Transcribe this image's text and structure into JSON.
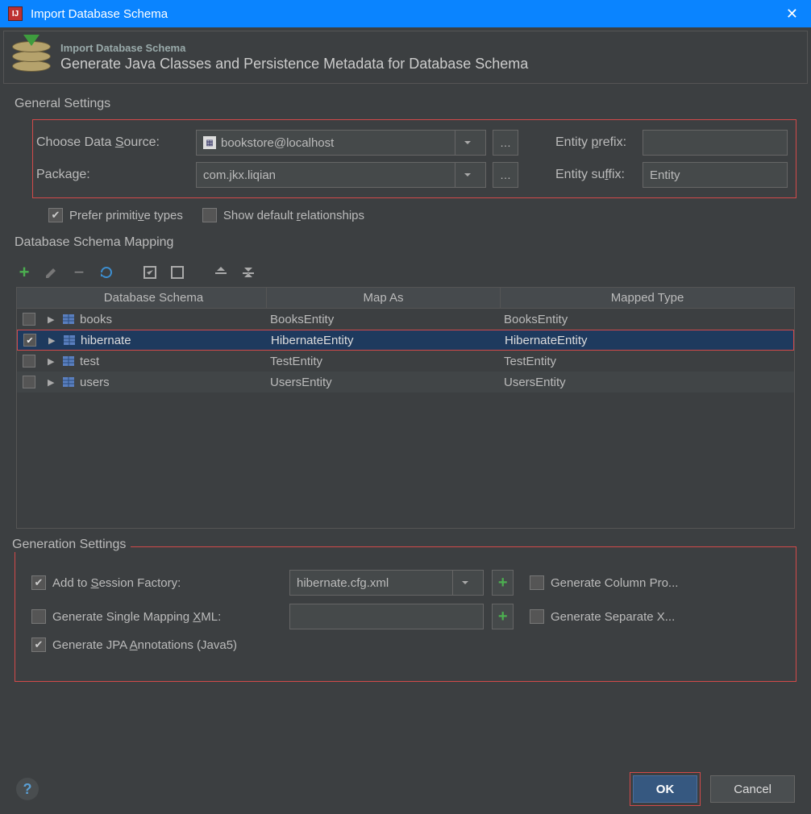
{
  "window": {
    "title": "Import Database Schema"
  },
  "banner": {
    "small": "Import Database Schema",
    "large": "Generate Java Classes and Persistence Metadata for Database Schema"
  },
  "general": {
    "section_label": "General Settings",
    "data_source_label": "Choose Data Source:",
    "data_source_value": "bookstore@localhost",
    "package_label": "Package:",
    "package_value": "com.jkx.liqian",
    "entity_prefix_label": "Entity prefix:",
    "entity_prefix_value": "",
    "entity_suffix_label": "Entity suffix:",
    "entity_suffix_value": "Entity",
    "prefer_primitive_label": "Prefer primitive types",
    "show_default_rel_label": "Show default relationships"
  },
  "mapping": {
    "section_label": "Database Schema Mapping",
    "columns": {
      "schema": "Database Schema",
      "map_as": "Map As",
      "mapped_type": "Mapped Type"
    },
    "rows": [
      {
        "checked": false,
        "name": "books",
        "map_as": "BooksEntity",
        "type": "BooksEntity",
        "selected": false
      },
      {
        "checked": true,
        "name": "hibernate",
        "map_as": "HibernateEntity",
        "type": "HibernateEntity",
        "selected": true
      },
      {
        "checked": false,
        "name": "test",
        "map_as": "TestEntity",
        "type": "TestEntity",
        "selected": false
      },
      {
        "checked": false,
        "name": "users",
        "map_as": "UsersEntity",
        "type": "UsersEntity",
        "selected": false
      }
    ]
  },
  "generation": {
    "section_label": "Generation Settings",
    "add_session_label": "Add to Session Factory:",
    "session_file": "hibernate.cfg.xml",
    "gen_column_label": "Generate Column Pro...",
    "gen_single_xml_label": "Generate Single Mapping XML:",
    "single_xml_value": "",
    "gen_separate_label": "Generate Separate X...",
    "gen_jpa_label": "Generate JPA Annotations (Java5)"
  },
  "footer": {
    "ok": "OK",
    "cancel": "Cancel"
  }
}
